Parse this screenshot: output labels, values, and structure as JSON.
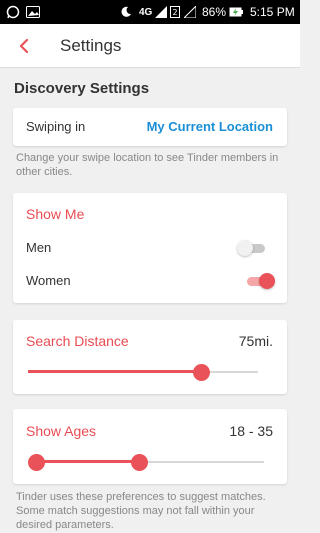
{
  "status_bar": {
    "network": "4G",
    "battery": "86%",
    "time": "5:15 PM"
  },
  "app_bar": {
    "title": "Settings"
  },
  "discovery": {
    "section_title": "Discovery Settings",
    "swiping_label": "Swiping in",
    "swiping_value": "My Current Location",
    "swiping_help": "Change your swipe location to see Tinder members in other cities."
  },
  "show_me": {
    "heading": "Show Me",
    "men_label": "Men",
    "men_on": false,
    "women_label": "Women",
    "women_on": true
  },
  "search_distance": {
    "heading": "Search Distance",
    "value_text": "75mi.",
    "level": 0.75
  },
  "show_ages": {
    "heading": "Show Ages",
    "value_text": "18 - 35",
    "min_level": 0,
    "max_level": 0.45
  },
  "footer": {
    "text": "Tinder uses these preferences to suggest matches. Some match suggestions may not fall within your desired parameters."
  },
  "colors": {
    "accent": "#ea5259",
    "link": "#1a8fd6",
    "toggle_on_track": "#f4a6a8",
    "toggle_off_track": "#c9c9c9",
    "toggle_off_thumb": "#f1f1f1"
  }
}
